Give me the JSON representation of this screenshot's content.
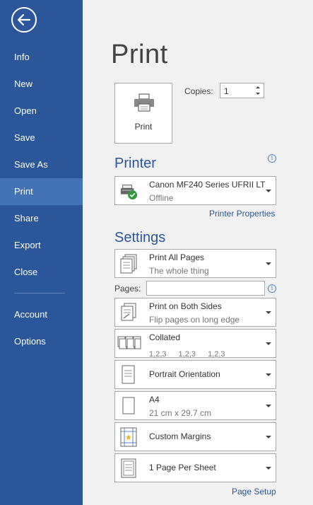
{
  "sidebar": {
    "items": [
      {
        "label": "Info"
      },
      {
        "label": "New"
      },
      {
        "label": "Open"
      },
      {
        "label": "Save"
      },
      {
        "label": "Save As"
      },
      {
        "label": "Print"
      },
      {
        "label": "Share"
      },
      {
        "label": "Export"
      },
      {
        "label": "Close"
      },
      {
        "label": "Account"
      },
      {
        "label": "Options"
      }
    ],
    "active": "Print"
  },
  "main": {
    "title": "Print",
    "print_button_label": "Print",
    "copies_label": "Copies:",
    "copies_value": "1",
    "printer": {
      "header": "Printer",
      "name": "Canon MF240 Series UFRII LT",
      "status": "Offline",
      "properties_link": "Printer Properties"
    },
    "settings": {
      "header": "Settings",
      "pages_label": "Pages:",
      "pages_value": "",
      "range": {
        "title": "Print All Pages",
        "subtitle": "The whole thing"
      },
      "sides": {
        "title": "Print on Both Sides",
        "subtitle": "Flip pages on long edge"
      },
      "collation": {
        "title": "Collated",
        "nums": [
          "1,2,3",
          "1,2,3",
          "1,2,3"
        ]
      },
      "orientation": {
        "title": "Portrait Orientation"
      },
      "paper": {
        "title": "A4",
        "subtitle": "21 cm x 29.7 cm"
      },
      "margins": {
        "title": "Custom Margins"
      },
      "per_sheet": {
        "title": "1 Page Per Sheet"
      },
      "page_setup_link": "Page Setup"
    }
  },
  "colors": {
    "sidebar_bg": "#2b579a",
    "sidebar_active": "#4372b6",
    "accent": "#2b579a",
    "main_bg": "#f1f1f1"
  }
}
